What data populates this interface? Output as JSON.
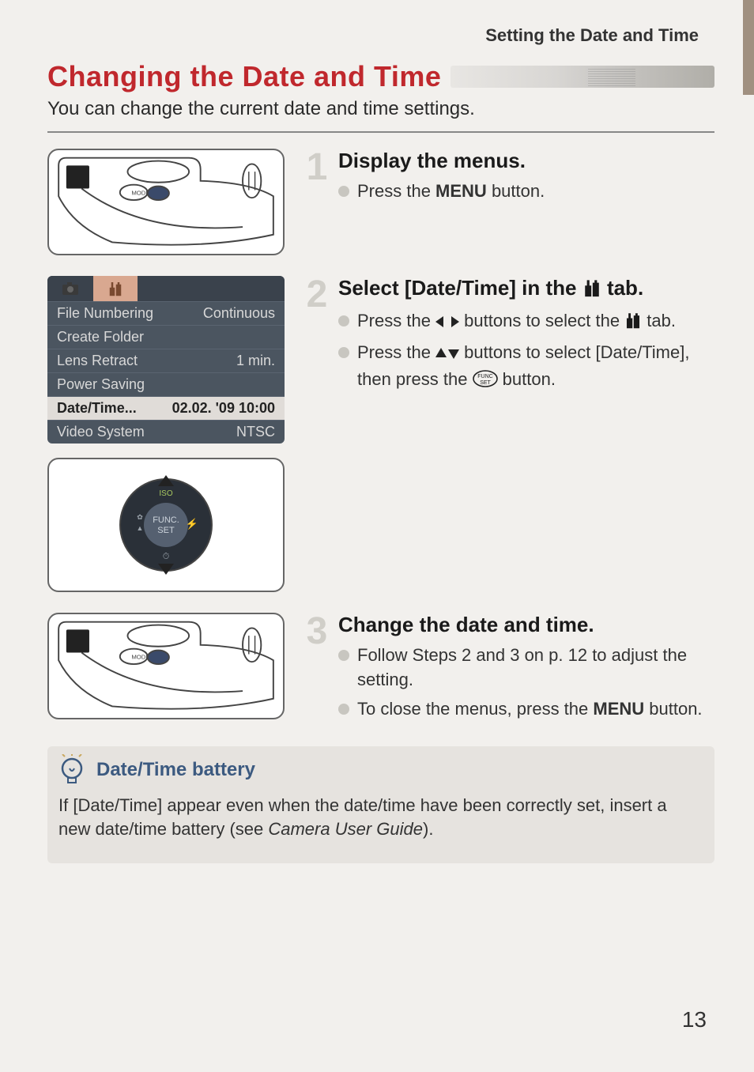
{
  "header": {
    "section_label": "Setting the Date and Time"
  },
  "title": "Changing the Date and Time",
  "intro": "You can change the current date and time settings.",
  "menu_screenshot": {
    "rows": [
      {
        "label": "File Numbering",
        "value": "Continuous"
      },
      {
        "label": "Create Folder",
        "value": ""
      },
      {
        "label": "Lens Retract",
        "value": "1 min."
      },
      {
        "label": "Power Saving",
        "value": ""
      },
      {
        "label": "Date/Time...",
        "value": "02.02. '09 10:00",
        "selected": true
      },
      {
        "label": "Video System",
        "value": "NTSC"
      }
    ]
  },
  "steps": [
    {
      "num": "1",
      "title": "Display the menus.",
      "bullets": [
        {
          "pre": "Press the ",
          "bold": "MENU",
          "post": " button."
        }
      ]
    },
    {
      "num": "2",
      "title_pre": "Select [Date/Time] in the ",
      "title_post": " tab.",
      "bullets": [
        {
          "text_html": "b2a"
        },
        {
          "text_html": "b2b"
        }
      ],
      "b2a_pre": "Press the ",
      "b2a_mid": " buttons to select the ",
      "b2a_post": " tab.",
      "b2b_pre": "Press the ",
      "b2b_mid": " buttons to select [Date/Time], then press the ",
      "b2b_post": " button."
    },
    {
      "num": "3",
      "title": "Change the date and time.",
      "bullets": [
        {
          "text": "Follow Steps 2 and 3 on p. 12 to adjust the setting."
        },
        {
          "pre": "To close the menus, press the ",
          "bold": "MENU",
          "post": " button."
        }
      ]
    }
  ],
  "info": {
    "title": "Date/Time battery",
    "text_pre": "If [Date/Time] appear even when the date/time have been correctly set, insert a new date/time battery (see ",
    "text_italic": "Camera User Guide",
    "text_post": ")."
  },
  "page_number": "13"
}
